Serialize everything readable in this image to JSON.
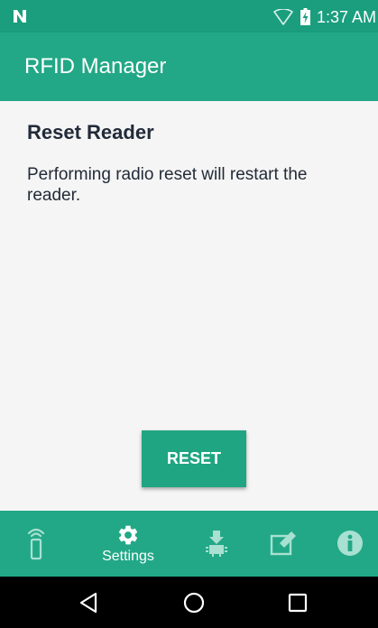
{
  "status_bar": {
    "time": "1:37 AM",
    "icons": [
      "n-logo-icon",
      "wifi-icon",
      "battery-charging-icon"
    ]
  },
  "app_bar": {
    "title": "RFID Manager"
  },
  "content": {
    "heading": "Reset Reader",
    "description": "Performing radio reset will restart the reader.",
    "reset_button_label": "RESET"
  },
  "bottom_nav": {
    "items": [
      {
        "icon": "rfid-reader-icon",
        "label": ""
      },
      {
        "icon": "gear-icon",
        "label": "Settings"
      },
      {
        "icon": "firmware-update-icon",
        "label": ""
      },
      {
        "icon": "edit-icon",
        "label": ""
      },
      {
        "icon": "info-icon",
        "label": ""
      }
    ],
    "active_index": 1
  },
  "system_nav": {
    "buttons": [
      "back-icon",
      "home-icon",
      "recents-icon"
    ]
  },
  "colors": {
    "status_bar": "#1a9e7e",
    "primary": "#22a886",
    "background": "#f5f5f5",
    "text": "#222b38",
    "nav_icon_inactive": "#a8e0d2"
  }
}
